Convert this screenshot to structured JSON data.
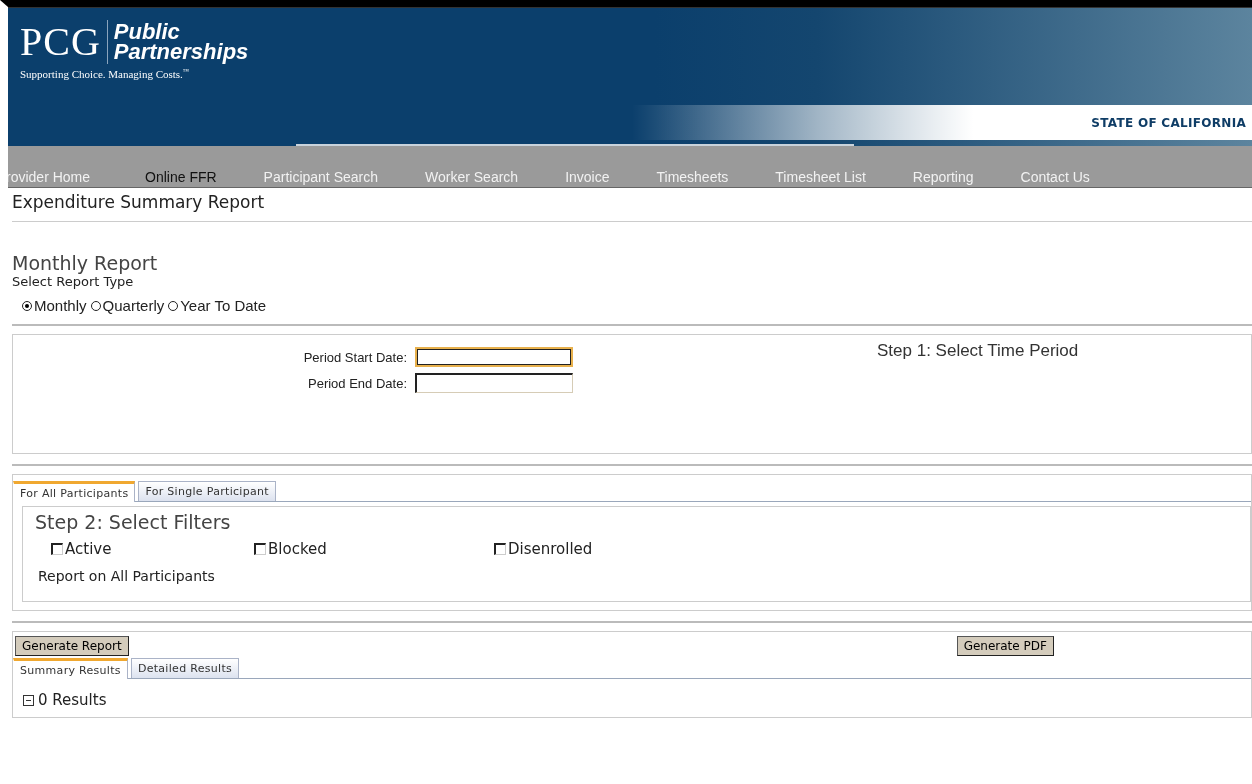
{
  "header": {
    "logo_mark": "PCG",
    "logo_name_1": "Public",
    "logo_name_2": "Partnerships",
    "tagline": "Supporting Choice. Managing Costs.",
    "trademark": "™",
    "state_label": "STATE OF CALIFORNIA"
  },
  "nav": [
    {
      "label": "rovider Home",
      "selected": false
    },
    {
      "label": "Online FFR",
      "selected": true
    },
    {
      "label": "Participant Search",
      "selected": false
    },
    {
      "label": "Worker Search",
      "selected": false
    },
    {
      "label": "Invoice",
      "selected": false
    },
    {
      "label": "Timesheets",
      "selected": false
    },
    {
      "label": "Timesheet List",
      "selected": false
    },
    {
      "label": "Reporting",
      "selected": false
    },
    {
      "label": "Contact Us",
      "selected": false
    }
  ],
  "page_title": "Expenditure Summary Report",
  "report_heading": "Monthly Report",
  "report_type_label": "Select Report Type",
  "report_types": [
    {
      "label": "Monthly",
      "selected": true
    },
    {
      "label": "Quarterly",
      "selected": false
    },
    {
      "label": "Year To Date",
      "selected": false
    }
  ],
  "step1": {
    "title": "Step 1: Select Time Period",
    "fields": [
      {
        "label": "Period Start Date:",
        "focused": true
      },
      {
        "label": "Period End Date:",
        "focused": false
      }
    ]
  },
  "filter_tabs": [
    {
      "label": "For All Participants",
      "selected": true
    },
    {
      "label": "For Single Participant",
      "selected": false
    }
  ],
  "step2": {
    "title": "Step 2: Select Filters",
    "filters": [
      {
        "label": "Active",
        "checked": false
      },
      {
        "label": "Blocked",
        "checked": false
      },
      {
        "label": "Disenrolled",
        "checked": false
      }
    ],
    "note": "Report on All Participants"
  },
  "buttons": {
    "generate_report": "Generate Report",
    "generate_pdf": "Generate PDF"
  },
  "result_tabs": [
    {
      "label": "Summary Results",
      "selected": true
    },
    {
      "label": "Detailed Results",
      "selected": false
    }
  ],
  "results": {
    "expanded": true,
    "text": "0 Results"
  }
}
